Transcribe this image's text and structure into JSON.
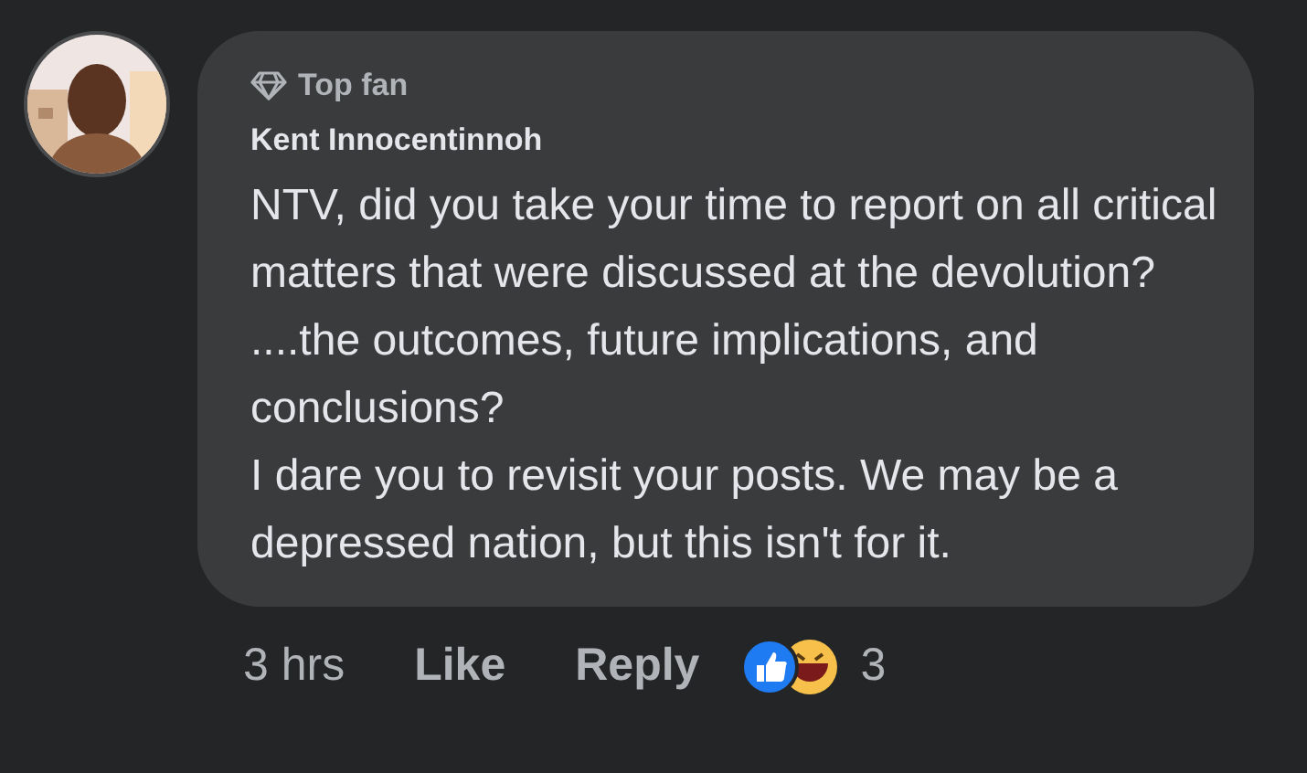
{
  "comment": {
    "badge": "Top fan",
    "author": "Kent Innocentinnoh",
    "text": "NTV, did you take your time to report on all critical matters that were discussed at the devolution? ....the outcomes, future implications, and conclusions?\nI dare you to revisit your posts. We may be a depressed nation, but this isn't for it.",
    "time": "3 hrs",
    "actions": [
      "Like",
      "Reply"
    ],
    "reaction_count": "3"
  }
}
